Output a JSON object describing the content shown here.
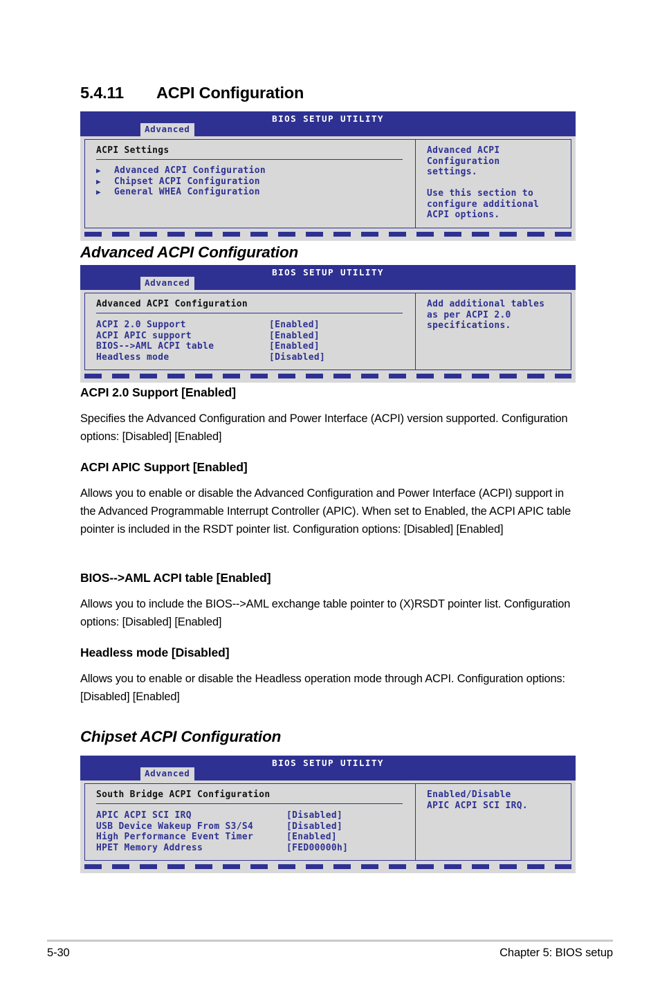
{
  "page": {
    "section_number": "5.4.11",
    "section_title": "ACPI Configuration",
    "footer_page": "5-30",
    "footer_chapter": "Chapter 5: BIOS setup",
    "accent_blue": "#2e3192",
    "panel_gray": "#d8d8d8"
  },
  "bios_common": {
    "utility_title": "BIOS SETUP UTILITY",
    "tab_label": "Advanced",
    "arrow_icon": "▶"
  },
  "screen1": {
    "panel_title": "ACPI Settings",
    "menu_items": [
      "Advanced ACPI Configuration",
      "Chipset ACPI Configuration",
      "General WHEA Configuration"
    ],
    "help_text": "Advanced ACPI\nConfiguration\nsettings.\n\nUse this section to\nconfigure additional\nACPI options."
  },
  "heading_advanced": "Advanced ACPI Configuration",
  "screen2": {
    "panel_title": "Advanced ACPI Configuration",
    "options": [
      {
        "label": "ACPI 2.0 Support",
        "value": "[Enabled]"
      },
      {
        "label": "ACPI APIC support",
        "value": "[Enabled]"
      },
      {
        "label": "BIOS-->AML ACPI table",
        "value": "[Enabled]"
      },
      {
        "label": "Headless mode",
        "value": "[Disabled]"
      }
    ],
    "help_text": "Add additional tables\nas per ACPI 2.0\nspecifications."
  },
  "body_sections": [
    {
      "heading": "ACPI 2.0 Support [Enabled]",
      "text": "Specifies the Advanced Configuration and Power Interface (ACPI) version supported. Configuration options: [Disabled] [Enabled]"
    },
    {
      "heading": "ACPI APIC Support [Enabled]",
      "text": "Allows you to enable or disable the Advanced Configuration and Power Interface (ACPI) support in the Advanced Programmable Interrupt Controller (APIC). When set to Enabled, the ACPI APIC table pointer is included in the RSDT pointer list. Configuration options: [Disabled] [Enabled]"
    },
    {
      "heading": "BIOS-->AML ACPI table [Enabled]",
      "text": "Allows you to include the BIOS-->AML exchange table pointer to (X)RSDT pointer list. Configuration options: [Disabled] [Enabled]"
    },
    {
      "heading": "Headless mode [Disabled]",
      "text": "Allows you to enable or disable the Headless operation mode through ACPI. Configuration options: [Disabled] [Enabled]"
    }
  ],
  "heading_chipset": "Chipset ACPI Configuration",
  "screen3": {
    "panel_title": "South Bridge ACPI Configuration",
    "options": [
      {
        "label": "APIC ACPI SCI IRQ",
        "value": "[Disabled]"
      },
      {
        "label": "USB Device Wakeup From S3/S4",
        "value": "[Disabled]"
      },
      {
        "label": "High Performance Event Timer",
        "value": "[Enabled]"
      },
      {
        "label": "HPET Memory Address",
        "value": "[FED00000h]"
      }
    ],
    "help_text": "Enabled/Disable\nAPIC ACPI SCI IRQ."
  }
}
